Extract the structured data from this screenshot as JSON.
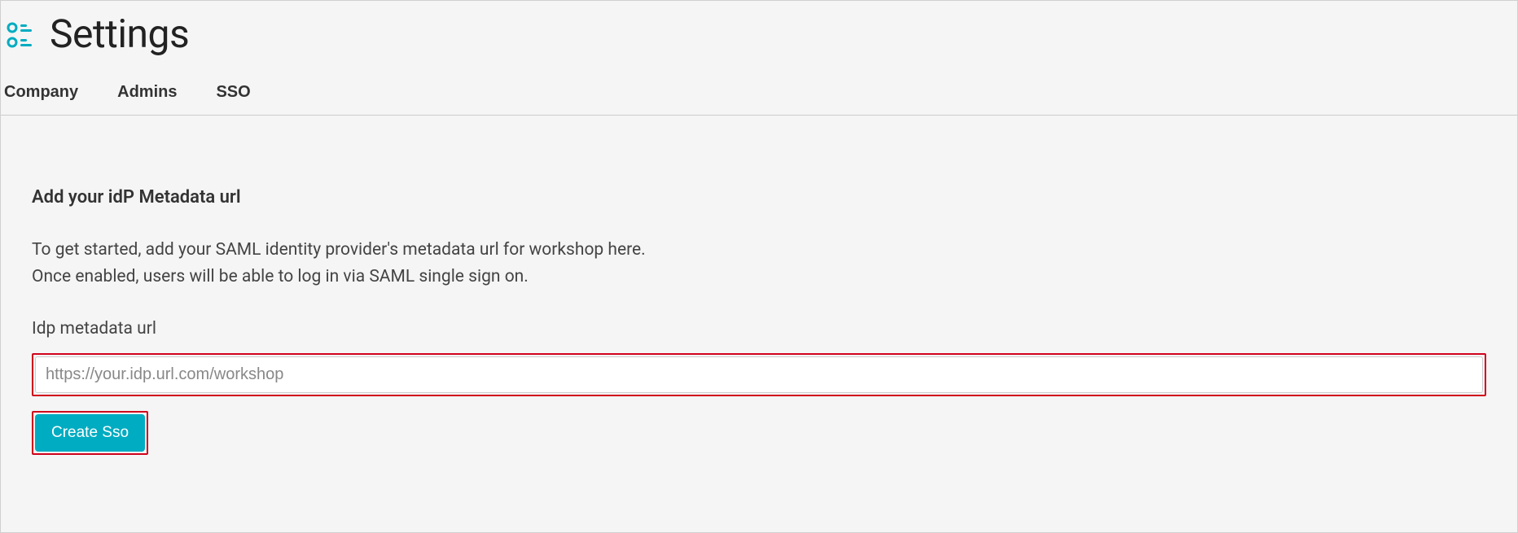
{
  "header": {
    "title": "Settings"
  },
  "tabs": [
    {
      "label": "Company"
    },
    {
      "label": "Admins"
    },
    {
      "label": "SSO"
    }
  ],
  "content": {
    "heading": "Add your idP Metadata url",
    "description_line1": "To get started, add your SAML identity provider's metadata url for workshop here.",
    "description_line2": "Once enabled, users will be able to log in via SAML single sign on.",
    "field_label": "Idp metadata url",
    "field_placeholder": "https://your.idp.url.com/workshop",
    "field_value": "",
    "button_label": "Create Sso"
  },
  "colors": {
    "accent": "#00acc1",
    "highlight_border": "#d0021b"
  }
}
